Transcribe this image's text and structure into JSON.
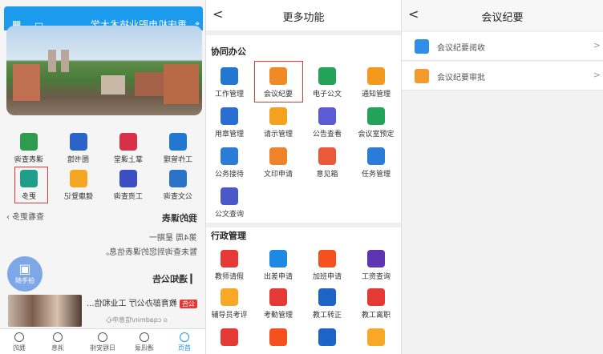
{
  "panel1": {
    "school_name": "重庆机电职业技术大学",
    "grid": [
      {
        "label": "课表查询",
        "color": "#2e9c4e"
      },
      {
        "label": "图书馆",
        "color": "#2b63c8"
      },
      {
        "label": "掌上课堂",
        "color": "#d9304a"
      },
      {
        "label": "工作管理",
        "color": "#2277d0"
      },
      {
        "label": "更多",
        "color": "#1f9e8a"
      },
      {
        "label": "健康登记",
        "color": "#f5a623"
      },
      {
        "label": "工资查询",
        "color": "#3b4ec2"
      },
      {
        "label": "公文查询",
        "color": "#2a73c9"
      }
    ],
    "view_more": "查看更多",
    "my_courses_title": "我的课表",
    "week_info": "第4周  星期一",
    "no_course_text": "暂未查询到您的课表信息。",
    "notice_title": "通知公告",
    "fab_label": "随手拍",
    "news_tag": "公告",
    "news_title": "教育部办公厅 工业和信...",
    "news_author": "cqadmin/信息中心",
    "tabs": [
      {
        "label": "首页"
      },
      {
        "label": "通讯录"
      },
      {
        "label": "日程安排"
      },
      {
        "label": "消息"
      },
      {
        "label": "我的"
      }
    ]
  },
  "panel2": {
    "back": "<",
    "title": "更多功能",
    "section1": "协同办公",
    "section2": "行政管理",
    "items": [
      {
        "label": "工作管理",
        "color": "#2277d0"
      },
      {
        "label": "会议纪要",
        "color": "#f08a24"
      },
      {
        "label": "电子公文",
        "color": "#23a35a"
      },
      {
        "label": "通知管理",
        "color": "#f39a1e"
      },
      {
        "label": "用章管理",
        "color": "#2b6ed2"
      },
      {
        "label": "请示管理",
        "color": "#f2a21f"
      },
      {
        "label": "公告查看",
        "color": "#5b5bd6"
      },
      {
        "label": "会议室预定",
        "color": "#23a35a"
      },
      {
        "label": "公务接待",
        "color": "#2b7bd9"
      },
      {
        "label": "文印申请",
        "color": "#f0822a"
      },
      {
        "label": "意见箱",
        "color": "#ea5a3a"
      },
      {
        "label": "任务管理",
        "color": "#2b7bd9"
      },
      {
        "label": "公文查询",
        "color": "#4a58c8"
      }
    ],
    "items2": [
      {
        "label": "教师请假",
        "color": "#e53935"
      },
      {
        "label": "出差申请",
        "color": "#1e88e5"
      },
      {
        "label": "加班申请",
        "color": "#f4511e"
      },
      {
        "label": "工资查询",
        "color": "#5e35b1"
      },
      {
        "label": "辅导员考评",
        "color": "#f9a825"
      },
      {
        "label": "考勤管理",
        "color": "#e53935"
      },
      {
        "label": "教工转正",
        "color": "#1e63c8"
      },
      {
        "label": "教工离职",
        "color": "#e53935"
      }
    ],
    "partial": [
      {
        "color": "#e53935"
      },
      {
        "color": "#f4511e"
      },
      {
        "color": "#1e63c8"
      },
      {
        "color": "#f9a825"
      }
    ]
  },
  "panel3": {
    "back": "<",
    "title": "会议纪要",
    "rows": [
      {
        "label": "会议纪要阅收",
        "color": "#2f8fe8"
      },
      {
        "label": "会议纪要审批",
        "color": "#f29a2e"
      }
    ],
    "arrow": ">"
  }
}
